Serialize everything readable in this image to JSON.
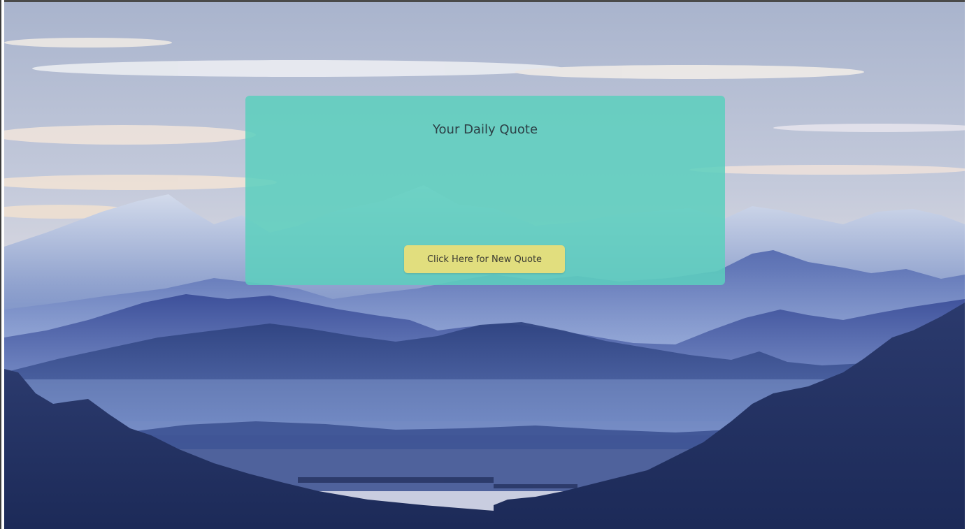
{
  "quote_card": {
    "title": "Your Daily Quote",
    "quote_text": "",
    "button_label": "Click Here for New Quote"
  },
  "colors": {
    "card": "#5ccfbe",
    "button": "#e8de7a",
    "title_text": "#2c3f45",
    "sky_top": "#b6bfd6",
    "mountain_dark": "#1f2f5e"
  },
  "background": {
    "scene": "mountain-landscape"
  }
}
